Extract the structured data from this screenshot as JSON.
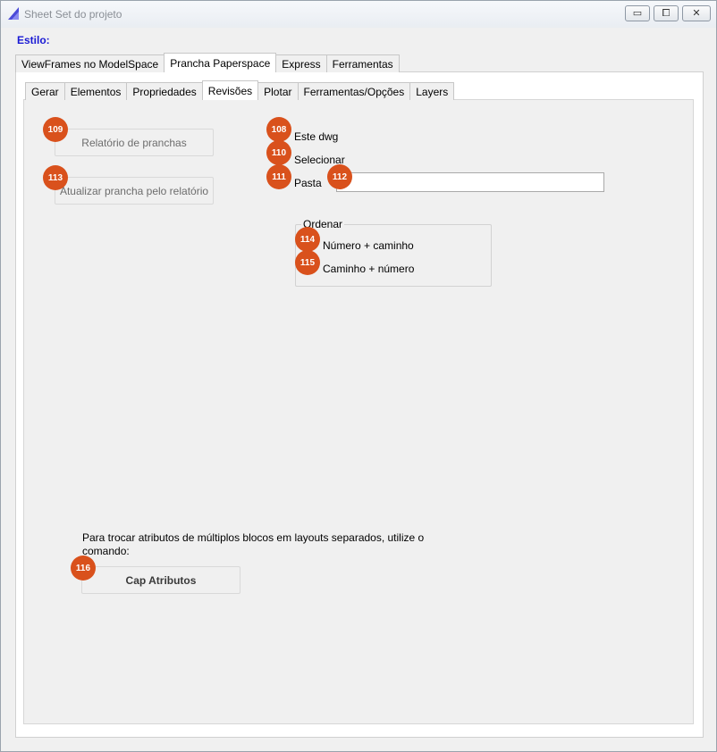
{
  "window": {
    "title": "Sheet Set do projeto",
    "icon": "triangle-app-icon",
    "controls": {
      "minimize": "▭",
      "maximize": "⧠",
      "close": "✕"
    }
  },
  "estilo_label": "Estilo:",
  "top_tabs": [
    {
      "label": "ViewFrames no ModelSpace",
      "active": false
    },
    {
      "label": "Prancha Paperspace",
      "active": true
    },
    {
      "label": "Express",
      "active": false
    },
    {
      "label": "Ferramentas",
      "active": false
    }
  ],
  "sub_tabs": [
    {
      "label": "Gerar",
      "active": false
    },
    {
      "label": "Elementos",
      "active": false
    },
    {
      "label": "Propriedades",
      "active": false
    },
    {
      "label": "Revisões",
      "active": true
    },
    {
      "label": "Plotar",
      "active": false
    },
    {
      "label": "Ferramentas/Opções",
      "active": false
    },
    {
      "label": "Layers",
      "active": false
    }
  ],
  "buttons": {
    "relatorio": "Relatório de pranchas",
    "atualizar": "Atualizar prancha pelo relatório",
    "cap_atributos": "Cap Atributos"
  },
  "options": {
    "este_dwg": "Este dwg",
    "selecionar": "Selecionar",
    "pasta": "Pasta",
    "pasta_value": ""
  },
  "ordenar": {
    "title": "Ordenar",
    "numero_caminho": "Número + caminho",
    "caminho_numero": "Caminho + número"
  },
  "info": {
    "line1": "Para trocar atributos de múltiplos blocos em layouts separados, utilize o",
    "line2": "comando:"
  },
  "badges": {
    "b108": "108",
    "b109": "109",
    "b110": "110",
    "b111": "111",
    "b112": "112",
    "b113": "113",
    "b114": "114",
    "b115": "115",
    "b116": "116"
  },
  "colors": {
    "badge": "#d9511c",
    "estilo": "#1a1ad4",
    "accent": "#4b4bd8"
  }
}
